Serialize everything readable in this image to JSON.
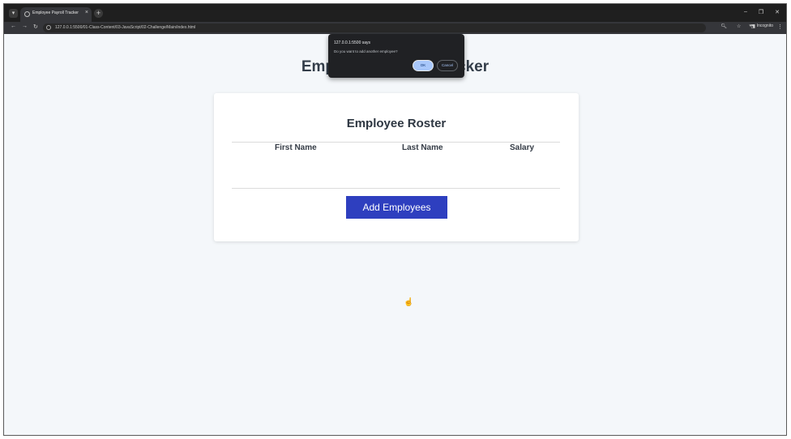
{
  "browser": {
    "tab_title": "Employee Payroll Tracker",
    "url": "127.0.0.1:5500/01-Class-Content/03-JavaScript/02-Challenge/Main/index.html",
    "profile_label": "Incognito"
  },
  "page": {
    "title": "Employee Payroll Tracker",
    "roster_title": "Employee Roster",
    "columns": [
      "First Name",
      "Last Name",
      "Salary"
    ],
    "add_button_label": "Add Employees",
    "button_color": "#2e3fbf"
  },
  "dialog": {
    "origin": "127.0.0.1:5500 says",
    "message": "Do you want to add another employee?",
    "ok_label": "OK",
    "cancel_label": "Cancel"
  }
}
